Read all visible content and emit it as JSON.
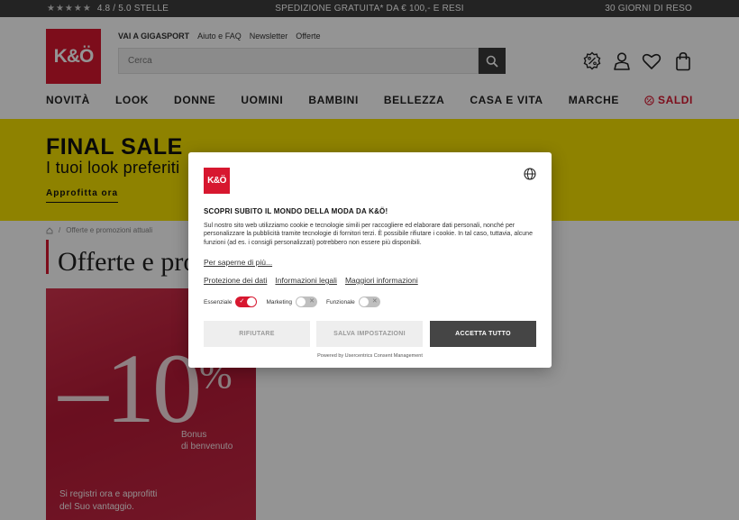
{
  "topbar": {
    "stars": "★★★★★",
    "rating": "4.8 / 5.0 STELLE",
    "shipping": "SPEDIZIONE GRATUITA* DA € 100,- E RESI",
    "returns": "30 GIORNI DI RESO"
  },
  "header": {
    "logo": "K&Ö",
    "utility_links": [
      "VAI A GIGASPORT",
      "Aiuto e FAQ",
      "Newsletter",
      "Offerte"
    ],
    "search_placeholder": "Cerca",
    "icons": [
      "discount-icon",
      "account-icon",
      "wishlist-icon",
      "bag-icon"
    ]
  },
  "nav": {
    "items": [
      "NOVITÀ",
      "LOOK",
      "DONNE",
      "UOMINI",
      "BAMBINI",
      "BELLEZZA",
      "CASA E VITA",
      "MARCHE"
    ],
    "sale": "SALDI"
  },
  "banner": {
    "title": "FINAL SALE",
    "subtitle": "I tuoi look preferiti",
    "cta": "Approfitta ora",
    "color": "#f5e100"
  },
  "breadcrumb": [
    "Offerte e promozioni attuali"
  ],
  "page": {
    "title": "Offerte e promozioni"
  },
  "promo": {
    "discount": "–10",
    "percent": "%",
    "bonus_line1": "Bonus",
    "bonus_line2": "di benvenuto",
    "register_line1": "Si registri ora e approfitti",
    "register_line2": "del Suo vantaggio."
  },
  "consent": {
    "logo": "K&Ö",
    "heading": "SCOPRI SUBITO IL MONDO DELLA MODA DA K&Ö!",
    "body": "Sul nostro sito web utilizziamo cookie e tecnologie simili per raccogliere ed elaborare dati personali, nonché per personalizzare la pubblicità tramite tecnologie di fornitori terzi. È possibile rifiutare i cookie. In tal caso, tuttavia, alcune funzioni (ad es. i consigli personalizzati) potrebbero non essere più disponibili.",
    "more_link": "Per saperne di più...",
    "links": [
      "Protezione dei dati",
      "Informazioni legali",
      "Maggiori informazioni"
    ],
    "toggles": {
      "essential": {
        "label": "Essenziale",
        "state": "on"
      },
      "marketing": {
        "label": "Marketing",
        "state": "off"
      },
      "functional": {
        "label": "Funzionale",
        "state": "off"
      }
    },
    "buttons": {
      "reject": "RIFIUTARE",
      "save": "SALVA IMPOSTAZIONI",
      "accept": "ACCETTA TUTTO"
    },
    "powered_by": "Powered by Usercentrics Consent Management"
  },
  "colors": {
    "brand_red": "#d7172f",
    "accept_button": "#454545",
    "overlay": "rgba(0,0,0,0.42)"
  }
}
